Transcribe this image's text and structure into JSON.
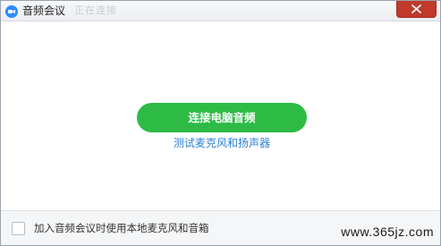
{
  "window": {
    "title": "音频会议",
    "ghost_text": "正在连接"
  },
  "main": {
    "connect_button_label": "连接电脑音频",
    "test_link_label": "测试麦克风和扬声器"
  },
  "footer": {
    "auto_join_label": "加入音频会议时使用本地麦克风和音箱",
    "auto_join_checked": false
  },
  "watermark": "www.365jz.com",
  "colors": {
    "accent_green": "#2dbb46",
    "link_blue": "#2b7fd6",
    "close_red": "#c0392b",
    "app_icon_blue": "#2d8cff"
  },
  "icons": {
    "app": "video-camera-icon",
    "close": "close-icon"
  }
}
